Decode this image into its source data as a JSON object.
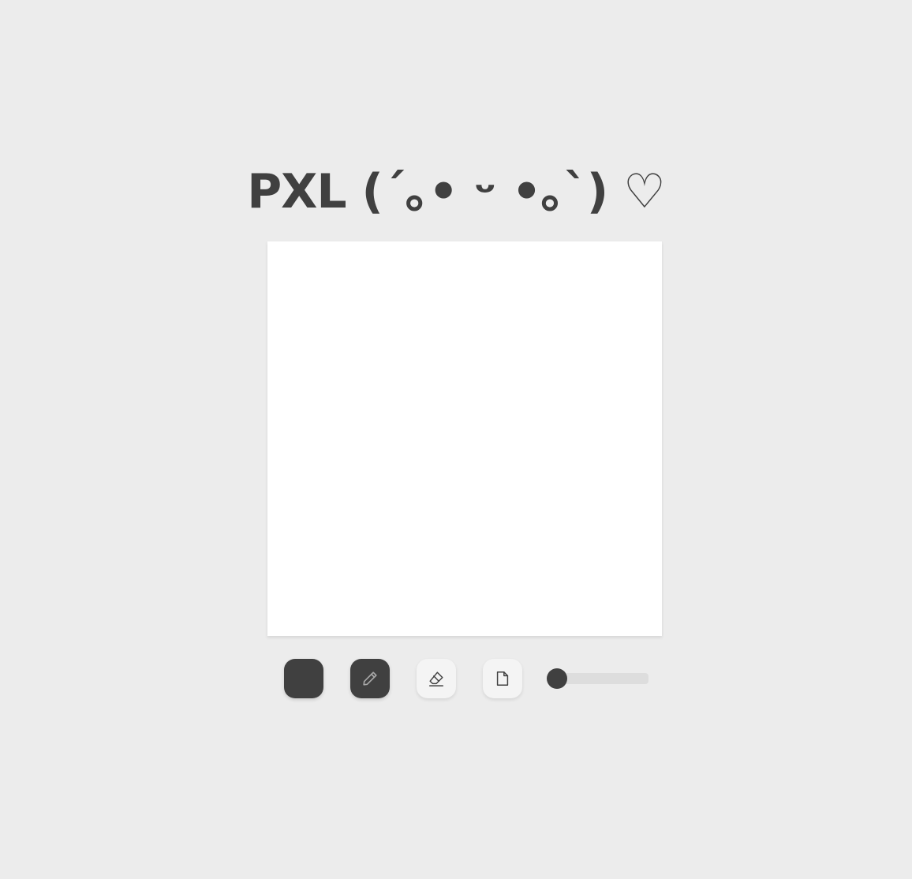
{
  "app": {
    "title": "PXL (´｡• ᵕ •｡`) ♡"
  },
  "toolbar": {
    "current_color": "#404040",
    "tools": [
      {
        "name": "color",
        "icon": "color-swatch-icon"
      },
      {
        "name": "pencil",
        "icon": "pencil-icon",
        "active": true
      },
      {
        "name": "eraser",
        "icon": "eraser-icon",
        "active": false
      },
      {
        "name": "clear",
        "icon": "new-page-icon",
        "active": false
      }
    ],
    "brush_size": {
      "value": 0,
      "min": 0,
      "max": 1
    }
  },
  "colors": {
    "background": "#ececec",
    "canvas": "#ffffff",
    "accent": "#404040",
    "button_light": "#f4f4f4",
    "track": "#dddddd",
    "pencil_icon": "#a8a8a8"
  }
}
